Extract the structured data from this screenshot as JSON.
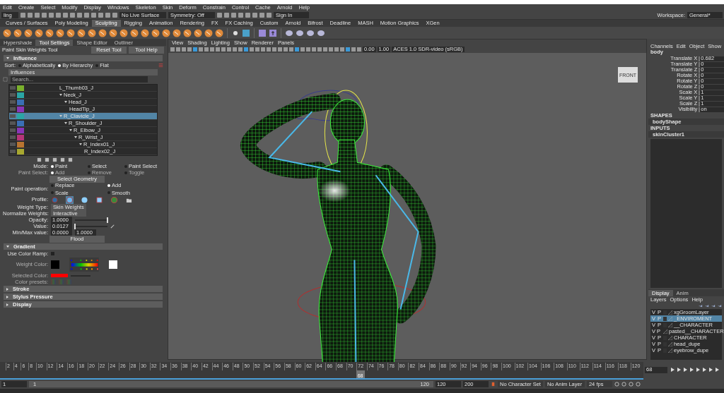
{
  "menu_bar": [
    "Edit",
    "Create",
    "Select",
    "Modify",
    "Display",
    "Windows",
    "Skeleton",
    "Skin",
    "Deform",
    "Constrain",
    "Control",
    "Cache",
    "Arnold",
    "Help"
  ],
  "status_line": {
    "mode": "ling",
    "live_surface": "No Live Surface",
    "symmetry": "Symmetry: Off",
    "sign_in": "Sign In",
    "workspace_label": "Workspace:",
    "workspace": "General*"
  },
  "shelf_tabs": [
    {
      "label": "Curves / Surfaces",
      "selected": false
    },
    {
      "label": "Poly Modeling",
      "selected": false
    },
    {
      "label": "Sculpting",
      "selected": true
    },
    {
      "label": "Rigging",
      "selected": false
    },
    {
      "label": "Animation",
      "selected": false
    },
    {
      "label": "Rendering",
      "selected": false
    },
    {
      "label": "FX",
      "selected": false
    },
    {
      "label": "FX Caching",
      "selected": false
    },
    {
      "label": "Custom",
      "selected": false
    },
    {
      "label": "Arnold",
      "selected": false
    },
    {
      "label": "Bifrost",
      "selected": false
    },
    {
      "label": "Deadline",
      "selected": false
    },
    {
      "label": "MASH",
      "selected": false
    },
    {
      "label": "Motion Graphics",
      "selected": false
    },
    {
      "label": "XGen",
      "selected": false
    }
  ],
  "tool_panel": {
    "tabs": [
      {
        "label": "Hypershade",
        "selected": false
      },
      {
        "label": "Tool Settings",
        "selected": true
      },
      {
        "label": "Shape Editor",
        "selected": false
      },
      {
        "label": "Outliner",
        "selected": false
      }
    ],
    "tool_name": "Paint Skin Weights Tool",
    "buttons": [
      "Reset Tool",
      "Tool Help"
    ],
    "influence_section": {
      "title": "Influence",
      "expanded": true
    },
    "sort": {
      "label": "Sort:",
      "options": [
        {
          "label": "Alphabetically",
          "selected": false
        },
        {
          "label": "By Hierarchy",
          "selected": true
        },
        {
          "label": "Flat",
          "selected": false
        }
      ]
    },
    "influences": {
      "header": "Influences",
      "search_placeholder": "Search...",
      "items": [
        {
          "name": "L_Thumb03_J",
          "color": "#7ab02c",
          "selected": false
        },
        {
          "name": "Neck_J",
          "color": "#2aa5a5",
          "selected": false,
          "children": [
            {
              "name": "Head_J",
              "color": "#3a6fb5",
              "selected": false,
              "children": [
                {
                  "name": "HeadTip_J",
                  "color": "#8a35b8",
                  "selected": false
                }
              ]
            }
          ]
        },
        {
          "name": "R_Clavicle_J",
          "color": "#2aa5a5",
          "selected": true,
          "children": [
            {
              "name": "R_Shoulder_J",
              "color": "#3a6fb5",
              "selected": false,
              "children": [
                {
                  "name": "R_Elbow_J",
                  "color": "#8a35b8",
                  "selected": false,
                  "children": [
                    {
                      "name": "R_Wrist_J",
                      "color": "#b5357a",
                      "selected": false,
                      "children": [
                        {
                          "name": "R_Index01_J",
                          "color": "#b87430",
                          "selected": false,
                          "children": [
                            {
                              "name": "R_Index02_J",
                              "color": "#a8a830",
                              "selected": false
                            }
                          ]
                        }
                      ]
                    }
                  ]
                }
              ]
            }
          ]
        }
      ]
    },
    "mode": {
      "label": "Mode:",
      "options": [
        {
          "label": "Paint",
          "selected": true
        },
        {
          "label": "Select",
          "selected": false
        },
        {
          "label": "Paint Select",
          "selected": false
        }
      ]
    },
    "paint_select": {
      "label": "Paint Select:",
      "disabled": true,
      "options": [
        {
          "label": "Add",
          "selected": true
        },
        {
          "label": "Remove",
          "selected": false
        },
        {
          "label": "Toggle",
          "selected": false
        }
      ]
    },
    "select_geometry": "Select Geometry",
    "paint_operation": {
      "label": "Paint operation:",
      "options": [
        {
          "label": "Replace",
          "selected": false
        },
        {
          "label": "Add",
          "selected": true
        },
        {
          "label": "Scale",
          "selected": false
        },
        {
          "label": "Smooth",
          "selected": false
        }
      ]
    },
    "profile": {
      "label": "Profile:",
      "options": [
        {
          "kind": "gaussian",
          "selected": false
        },
        {
          "kind": "soft",
          "selected": true
        },
        {
          "kind": "solid",
          "selected": false
        },
        {
          "kind": "square",
          "selected": false
        },
        {
          "kind": "image",
          "selected": false
        },
        {
          "kind": "folder",
          "selected": false
        }
      ]
    },
    "weight_type": {
      "label": "Weight Type:",
      "value": "Skin Weights"
    },
    "normalize": {
      "label": "Normalize Weights:",
      "value": "Interactive"
    },
    "opacity": {
      "label": "Opacity:",
      "value": "1.0000",
      "level": 1
    },
    "value": {
      "label": "Value:",
      "value": "0.0127",
      "level": 0.01
    },
    "min_max": {
      "label": "Min/Max value:",
      "min": "0.0000",
      "max": "1.0000"
    },
    "flood": "Flood",
    "gradient_section": {
      "title": "Gradient",
      "expanded": true
    },
    "use_color_ramp": {
      "label": "Use Color Ramp:",
      "checked": false
    },
    "weight_color": {
      "label": "Weight Color:"
    },
    "selected_color": {
      "label": "Selected Color:",
      "color": "#ff0000"
    },
    "color_presets": {
      "label": "Color presets:"
    },
    "collapsed_sections": [
      {
        "title": "Stroke",
        "expanded": false
      },
      {
        "title": "Stylus Pressure",
        "expanded": false
      },
      {
        "title": "Display",
        "expanded": false
      }
    ]
  },
  "viewport": {
    "menus": [
      "View",
      "Shading",
      "Lighting",
      "Show",
      "Renderer",
      "Panels"
    ],
    "exposure": "0.00",
    "gamma": "1.00",
    "color_space": "ACES 1.0 SDR-video (sRGB)",
    "view_cube": "FRONT"
  },
  "channel_box": {
    "menus": [
      "Channels",
      "Edit",
      "Object",
      "Show"
    ],
    "object": "body",
    "channels": [
      {
        "name": "Translate X",
        "value": "0.682"
      },
      {
        "name": "Translate Y",
        "value": "0"
      },
      {
        "name": "Translate Z",
        "value": "0"
      },
      {
        "name": "Rotate X",
        "value": "0"
      },
      {
        "name": "Rotate Y",
        "value": "0"
      },
      {
        "name": "Rotate Z",
        "value": "0"
      },
      {
        "name": "Scale X",
        "value": "1"
      },
      {
        "name": "Scale Y",
        "value": "1"
      },
      {
        "name": "Scale Z",
        "value": "1"
      },
      {
        "name": "Visibility",
        "value": "on"
      }
    ],
    "shapes_header": "SHAPES",
    "shape": "bodyShape",
    "inputs_header": "INPUTS",
    "input": "skinCluster1"
  },
  "layer_editor": {
    "tabs": [
      {
        "label": "Display",
        "selected": true
      },
      {
        "label": "Anim",
        "selected": false
      }
    ],
    "menus": [
      "Layers",
      "Options",
      "Help"
    ],
    "layers": [
      {
        "v": "V",
        "p": "P",
        "name": "xgGroomLayer",
        "selected": false
      },
      {
        "v": "V",
        "p": "P",
        "name": "_ENVIROMENT",
        "selected": true
      },
      {
        "v": "V",
        "p": "P",
        "name": "__CHARACTER",
        "selected": false
      },
      {
        "v": "V",
        "p": "P",
        "name": "pasted__CHARACTER",
        "selected": false
      },
      {
        "v": "V",
        "p": "P",
        "name": "CHARACTER",
        "selected": false
      },
      {
        "v": "V",
        "p": "P",
        "name": "head_dupe",
        "selected": false
      },
      {
        "v": "V",
        "p": "P",
        "name": "eyebrow_dupe",
        "selected": false
      }
    ]
  },
  "timeline": {
    "ticks": [
      "2",
      "4",
      "6",
      "8",
      "10",
      "12",
      "14",
      "16",
      "18",
      "20",
      "22",
      "24",
      "26",
      "28",
      "30",
      "32",
      "34",
      "36",
      "38",
      "40",
      "42",
      "44",
      "46",
      "48",
      "50",
      "52",
      "54",
      "56",
      "58",
      "60",
      "62",
      "64",
      "66",
      "68",
      "70",
      "72",
      "74",
      "76",
      "78",
      "80",
      "82",
      "84",
      "86",
      "88",
      "90",
      "92",
      "94",
      "96",
      "98",
      "100",
      "102",
      "104",
      "106",
      "108",
      "110",
      "112",
      "114",
      "116",
      "118",
      "120"
    ],
    "current_frame": "68",
    "level": 0.56,
    "frame_field": "68"
  },
  "range": {
    "start": "1",
    "range_start": "1",
    "range_end": "120",
    "end_display": "120",
    "end": "200",
    "character_set": "No Character Set",
    "anim_layer": "No Anim Layer",
    "fps": "24 fps"
  }
}
